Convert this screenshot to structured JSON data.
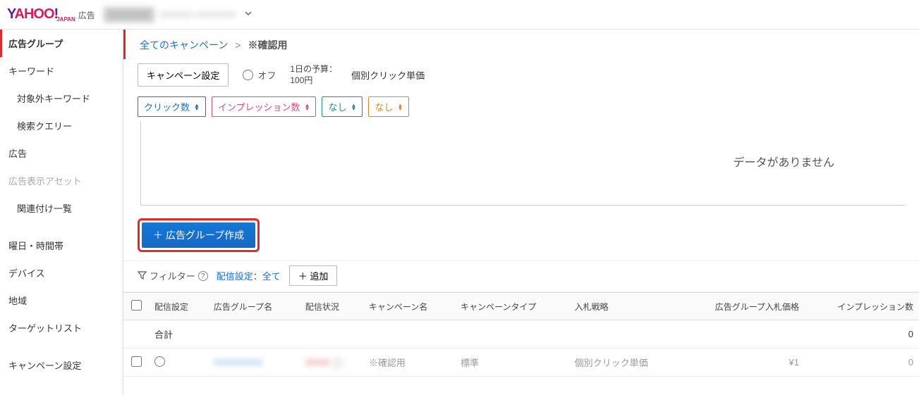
{
  "header": {
    "logo_ad_label": "広告",
    "blurred1": "XXXXXXX",
    "blurred2": "XXXXXX XXXXXXX"
  },
  "sidebar": {
    "items": [
      {
        "label": "広告グループ",
        "active": true
      },
      {
        "label": "キーワード"
      },
      {
        "label": "対象外キーワード",
        "sub": true
      },
      {
        "label": "検索クエリー",
        "sub": true
      },
      {
        "label": "広告"
      },
      {
        "label": "広告表示アセット",
        "disabled": true
      },
      {
        "label": "関連付け一覧",
        "sub": true
      },
      {
        "label": "曜日・時間帯",
        "gap": true
      },
      {
        "label": "デバイス"
      },
      {
        "label": "地域"
      },
      {
        "label": "ターゲットリスト"
      },
      {
        "label": "キャンペーン設定",
        "gap": true
      }
    ]
  },
  "breadcrumb": {
    "all": "全てのキャンペーン",
    "current": "※確認用"
  },
  "campaign_bar": {
    "settings_btn": "キャンペーン設定",
    "status": "オフ",
    "budget_label": "1日の予算：",
    "budget_value": "100円",
    "bid_type": "個別クリック単価"
  },
  "metrics": [
    {
      "label": "クリック数",
      "cls": "mp-blue"
    },
    {
      "label": "インプレッション数",
      "cls": "mp-pink"
    },
    {
      "label": "なし",
      "cls": "mp-teal"
    },
    {
      "label": "なし",
      "cls": "mp-orange"
    }
  ],
  "chart": {
    "empty_msg": "データがありません"
  },
  "create_btn": "広告グループ作成",
  "filter_bar": {
    "filter_label": "フィルター",
    "delivery_label": "配信設定：全て",
    "add_label": "追加"
  },
  "table": {
    "headers": [
      "配信設定",
      "広告グループ名",
      "配信状況",
      "キャンペーン名",
      "キャンペーンタイプ",
      "入札戦略",
      "広告グループ入札価格",
      "インプレッション数"
    ],
    "total_label": "合計",
    "total_impr": "0",
    "row": {
      "campaign": "※確認用",
      "type": "標準",
      "strategy": "個別クリック単価",
      "bid": "¥1",
      "impr": "0"
    }
  }
}
